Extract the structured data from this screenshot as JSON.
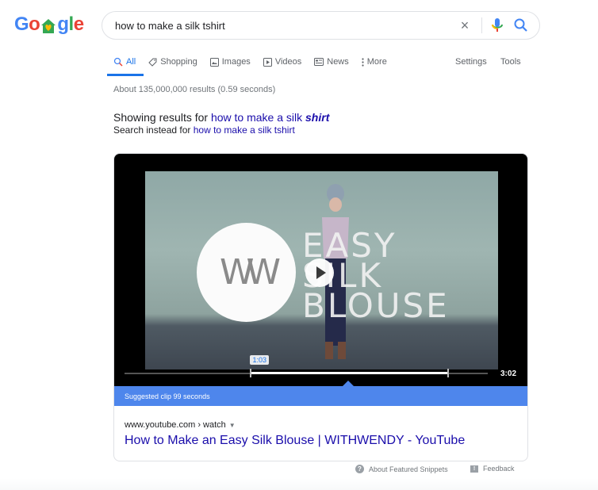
{
  "logo": {
    "letters": [
      "G",
      "o",
      "",
      "g",
      "l",
      "e"
    ],
    "alt": "Google"
  },
  "search": {
    "query": "how to make a silk tshirt",
    "clear_icon": "×"
  },
  "tabs": [
    {
      "label": "All",
      "icon": "search-icon",
      "active": true
    },
    {
      "label": "Shopping",
      "icon": "tag-icon"
    },
    {
      "label": "Images",
      "icon": "image-icon"
    },
    {
      "label": "Videos",
      "icon": "play-square-icon"
    },
    {
      "label": "News",
      "icon": "newspaper-icon"
    },
    {
      "label": "More",
      "icon": "kebab-icon"
    }
  ],
  "settings_label": "Settings",
  "tools_label": "Tools",
  "result_stats": "About 135,000,000 results (0.59 seconds)",
  "spelling": {
    "showing_prefix": "Showing results for ",
    "corrected_plain": "how to make a silk ",
    "corrected_emph": "shirt",
    "instead_prefix": "Search instead for ",
    "original": "how to make a silk tshirt"
  },
  "featured": {
    "video": {
      "overlay_logo": "WW",
      "overlay_title": [
        "EASY",
        "SILK",
        "BLOUSE"
      ],
      "clip_start": "1:03",
      "duration": "3:02",
      "clip_start_fraction": 0.346,
      "clip_end_fraction": 0.89
    },
    "suggested_clip": "Suggested clip 99 seconds",
    "cite": "www.youtube.com › watch",
    "title": "How to Make an Easy Silk Blouse | WITHWENDY - YouTube"
  },
  "footer": {
    "about": "About Featured Snippets",
    "feedback": "Feedback"
  },
  "colors": {
    "accent": "#1a73e8",
    "link": "#1a0dab",
    "clip_bar": "#4e86ec"
  }
}
